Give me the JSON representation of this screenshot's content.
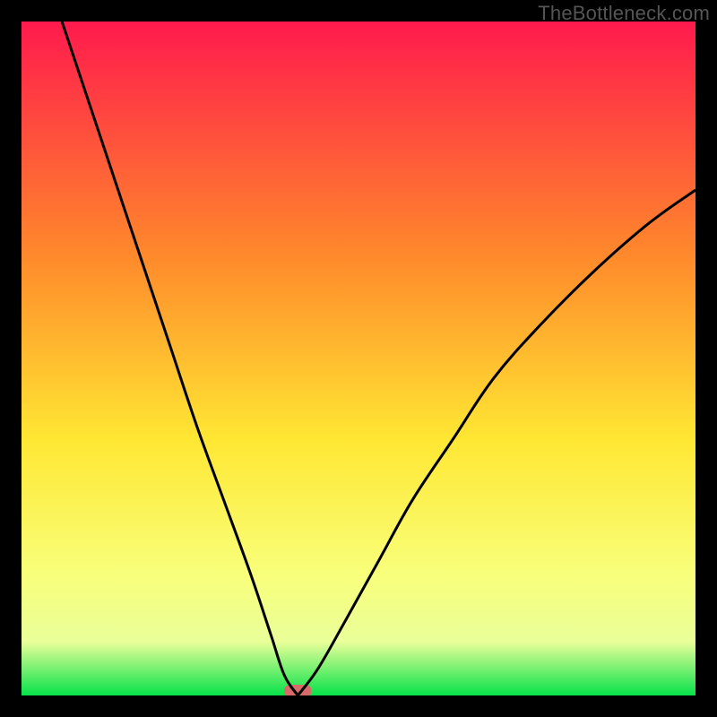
{
  "watermark": "TheBottleneck.com",
  "chart_data": {
    "type": "line",
    "title": "",
    "xlabel": "",
    "ylabel": "",
    "xlim": [
      0,
      100
    ],
    "ylim": [
      0,
      100
    ],
    "grid": false,
    "legend": false,
    "gradient_colors": {
      "top": "#ff1a4d",
      "mid_upper": "#ff8a2b",
      "mid": "#ffe733",
      "mid_lower": "#f8ff7a",
      "band": "#eaff99",
      "bottom": "#07e24a"
    },
    "minimum_marker": {
      "x": 41,
      "y": 0,
      "color": "#d86a6a"
    },
    "series": [
      {
        "name": "left-branch",
        "x": [
          6,
          10,
          14,
          18,
          22,
          26,
          30,
          34,
          37,
          39,
          41
        ],
        "y": [
          100,
          88,
          76,
          64,
          52,
          40,
          29,
          18,
          9,
          3,
          0
        ]
      },
      {
        "name": "right-branch",
        "x": [
          41,
          44,
          48,
          53,
          58,
          64,
          70,
          77,
          85,
          93,
          100
        ],
        "y": [
          0,
          4,
          11,
          20,
          29,
          38,
          47,
          55,
          63,
          70,
          75
        ]
      }
    ]
  }
}
